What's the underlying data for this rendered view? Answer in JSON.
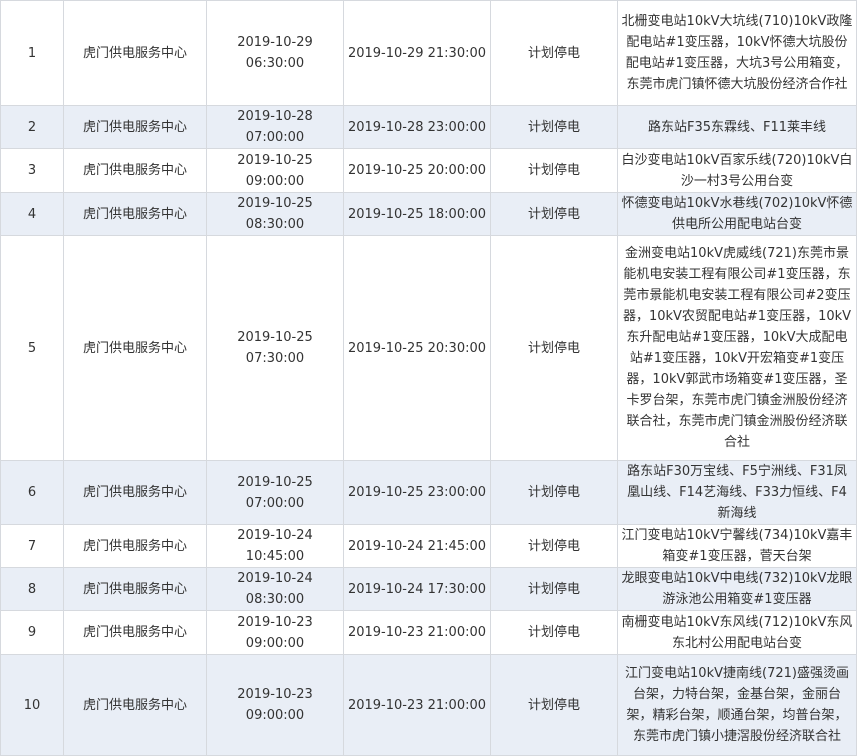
{
  "rows": [
    {
      "no": "1",
      "org": "虎门供电服务中心",
      "start": "2019-10-29 06:30:00",
      "end": "2019-10-29 21:30:00",
      "type": "计划停电",
      "area": "北栅变电站10kV大坑线(710)10kV政隆配电站#1变压器，10kV怀德大坑股份配电站#1变压器，大坑3号公用箱变，东莞市虎门镇怀德大坑股份经济合作社"
    },
    {
      "no": "2",
      "org": "虎门供电服务中心",
      "start": "2019-10-28 07:00:00",
      "end": "2019-10-28 23:00:00",
      "type": "计划停电",
      "area": "路东站F35东霖线、F11莱丰线"
    },
    {
      "no": "3",
      "org": "虎门供电服务中心",
      "start": "2019-10-25 09:00:00",
      "end": "2019-10-25 20:00:00",
      "type": "计划停电",
      "area": "白沙变电站10kV百家乐线(720)10kV白沙一村3号公用台变"
    },
    {
      "no": "4",
      "org": "虎门供电服务中心",
      "start": "2019-10-25 08:30:00",
      "end": "2019-10-25 18:00:00",
      "type": "计划停电",
      "area": "怀德变电站10kV水巷线(702)10kV怀德供电所公用配电站台变"
    },
    {
      "no": "5",
      "org": "虎门供电服务中心",
      "start": "2019-10-25 07:30:00",
      "end": "2019-10-25 20:30:00",
      "type": "计划停电",
      "area": "金洲变电站10kV虎威线(721)东莞市景能机电安装工程有限公司#1变压器，东莞市景能机电安装工程有限公司#2变压器，10kV农贸配电站#1变压器，10kV东升配电站#1变压器，10kV大成配电站#1变压器，10kV开宏箱变#1变压器，10kV郭武市场箱变#1变压器，圣卡罗台架，东莞市虎门镇金洲股份经济联合社，东莞市虎门镇金洲股份经济联合社"
    },
    {
      "no": "6",
      "org": "虎门供电服务中心",
      "start": "2019-10-25 07:00:00",
      "end": "2019-10-25 23:00:00",
      "type": "计划停电",
      "area": "路东站F30万宝线、F5宁洲线、F31凤凰山线、F14艺海线、F33力恒线、F4新海线"
    },
    {
      "no": "7",
      "org": "虎门供电服务中心",
      "start": "2019-10-24 10:45:00",
      "end": "2019-10-24 21:45:00",
      "type": "计划停电",
      "area": "江门变电站10kV宁馨线(734)10kV嘉丰箱变#1变压器，菅天台架"
    },
    {
      "no": "8",
      "org": "虎门供电服务中心",
      "start": "2019-10-24 08:30:00",
      "end": "2019-10-24 17:30:00",
      "type": "计划停电",
      "area": "龙眼变电站10kV中电线(732)10kV龙眼游泳池公用箱变#1变压器"
    },
    {
      "no": "9",
      "org": "虎门供电服务中心",
      "start": "2019-10-23 09:00:00",
      "end": "2019-10-23 21:00:00",
      "type": "计划停电",
      "area": "南栅变电站10kV东风线(712)10kV东风东北村公用配电站台变"
    },
    {
      "no": "10",
      "org": "虎门供电服务中心",
      "start": "2019-10-23 09:00:00",
      "end": "2019-10-23 21:00:00",
      "type": "计划停电",
      "area": "江门变电站10kV捷南线(721)盛强烫画台架，力特台架，金基台架，金丽台架，精彩台架，顺通台架，均普台架，东莞市虎门镇小捷滘股份经济联合社"
    }
  ]
}
